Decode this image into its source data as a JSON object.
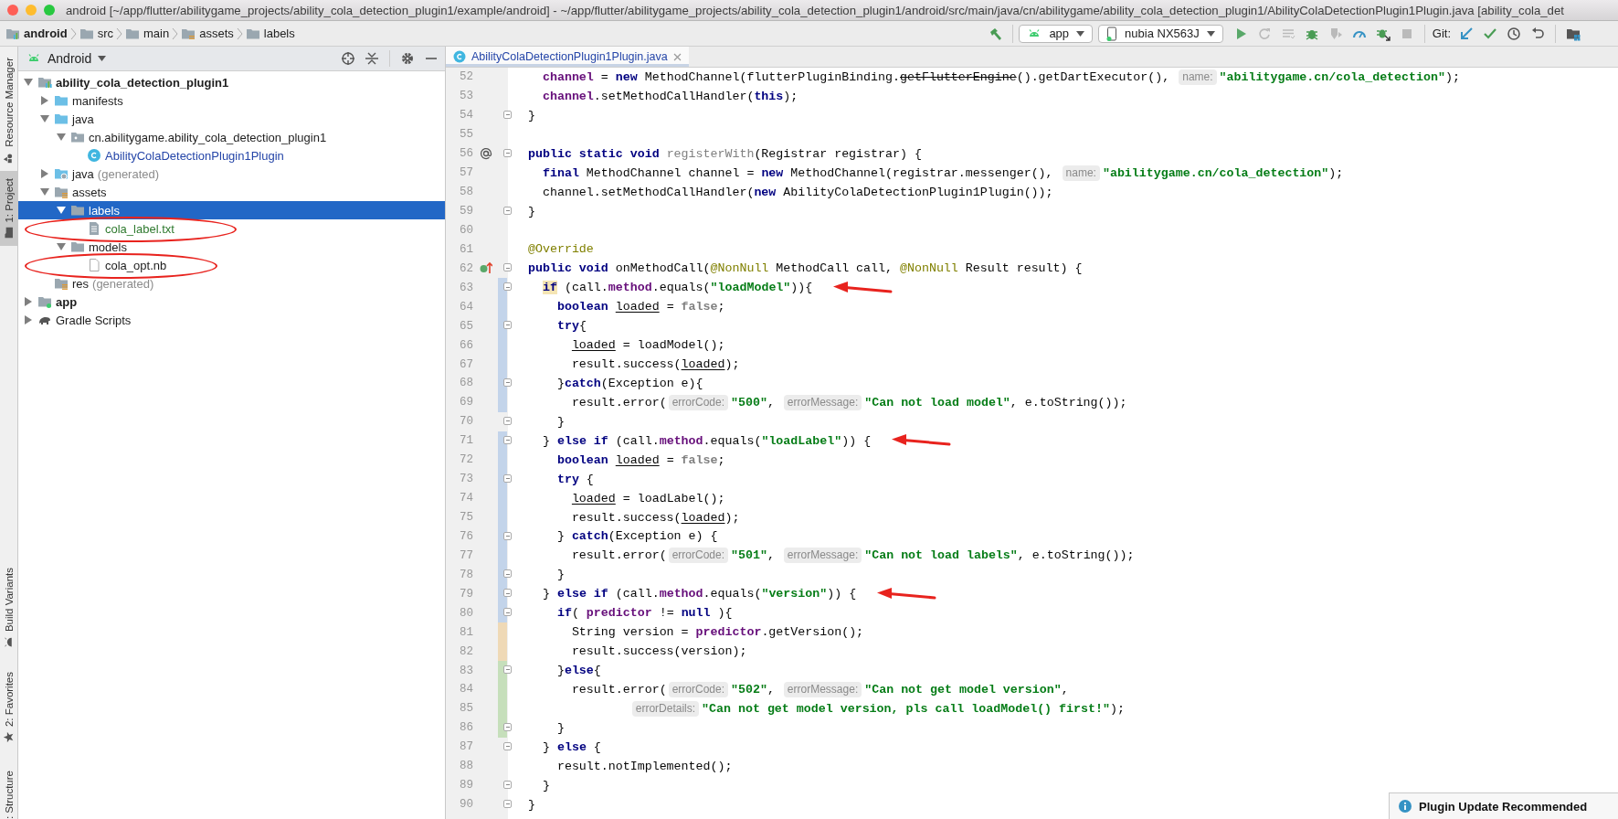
{
  "window": {
    "title": "android [~/app/flutter/abilitygame_projects/ability_cola_detection_plugin1/example/android] - ~/app/flutter/abilitygame_projects/ability_cola_detection_plugin1/android/src/main/java/cn/abilitygame/ability_cola_detection_plugin1/AbilityColaDetectionPlugin1Plugin.java [ability_cola_det"
  },
  "breadcrumbs": [
    {
      "label": "android",
      "kind": "module"
    },
    {
      "label": "src",
      "kind": "folder"
    },
    {
      "label": "main",
      "kind": "folder"
    },
    {
      "label": "assets",
      "kind": "resource-folder"
    },
    {
      "label": "labels",
      "kind": "folder"
    }
  ],
  "toolbar": [
    {
      "kind": "build",
      "disabled": false
    },
    {
      "kind": "separator"
    },
    {
      "kind": "config-dropdown",
      "label": "app",
      "disabled": false
    },
    {
      "kind": "device-dropdown",
      "label": "nubia NX563J",
      "disabled": false
    },
    {
      "kind": "run",
      "disabled": false
    },
    {
      "kind": "rerun",
      "disabled": true
    },
    {
      "kind": "apply-changes",
      "disabled": true
    },
    {
      "kind": "debug",
      "disabled": false
    },
    {
      "kind": "coverage",
      "disabled": true
    },
    {
      "kind": "profile",
      "disabled": false
    },
    {
      "kind": "attach-debugger",
      "disabled": false
    },
    {
      "kind": "stop",
      "disabled": true
    },
    {
      "kind": "separator"
    },
    {
      "kind": "label",
      "label": "Git:"
    },
    {
      "kind": "vcs-update",
      "disabled": false
    },
    {
      "kind": "vcs-commit",
      "disabled": false
    },
    {
      "kind": "history",
      "disabled": false
    },
    {
      "kind": "rollback",
      "disabled": false
    },
    {
      "kind": "separator"
    },
    {
      "kind": "project-structure",
      "disabled": false
    }
  ],
  "side_strip": {
    "top_tabs": [
      {
        "label": "Resource Manager",
        "kind": "resources",
        "selected": false
      },
      {
        "label": "1: Project",
        "kind": "project",
        "selected": true
      }
    ],
    "bottom_tabs": [
      {
        "label": "Build Variants",
        "kind": "build-variants",
        "selected": false
      },
      {
        "label": "2: Favorites",
        "kind": "favorites",
        "selected": false
      },
      {
        "label": ": Structure",
        "kind": "structure",
        "selected": false
      }
    ]
  },
  "project_panel": {
    "view": "Android",
    "tree": [
      {
        "label": "ability_cola_detection_plugin1",
        "kind": "module",
        "expanded": true,
        "selected": false,
        "marked": false,
        "children": [
          {
            "label": "manifests",
            "kind": "source-folder",
            "expanded": false,
            "selected": false,
            "marked": false
          },
          {
            "label": "java",
            "kind": "source-folder",
            "expanded": true,
            "selected": false,
            "marked": false,
            "children": [
              {
                "label": "cn.abilitygame.ability_cola_detection_plugin1",
                "kind": "package",
                "expanded": true,
                "selected": false,
                "marked": false,
                "children": [
                  {
                    "label": "AbilityColaDetectionPlugin1Plugin",
                    "kind": "class",
                    "selected": false,
                    "color": "#2445a8",
                    "marked": false
                  }
                ]
              }
            ]
          },
          {
            "label": "java",
            "note": "(generated)",
            "kind": "generated-folder",
            "expanded": false,
            "selected": false,
            "marked": false
          },
          {
            "label": "assets",
            "kind": "resource-folder",
            "expanded": true,
            "selected": false,
            "marked": false,
            "children": [
              {
                "label": "labels",
                "kind": "folder",
                "expanded": true,
                "selected": true,
                "marked": false,
                "children": [
                  {
                    "label": "cola_label.txt",
                    "kind": "text-file",
                    "selected": false,
                    "color": "#2f7a2f",
                    "marked": true
                  }
                ]
              },
              {
                "label": "models",
                "kind": "folder",
                "expanded": true,
                "selected": false,
                "marked": false,
                "children": [
                  {
                    "label": "cola_opt.nb",
                    "kind": "file",
                    "selected": false,
                    "marked": true
                  }
                ]
              }
            ]
          },
          {
            "label": "res",
            "note": "(generated)",
            "kind": "resource-folder",
            "selected": false,
            "marked": false
          }
        ]
      },
      {
        "label": "app",
        "kind": "app-module",
        "expanded": false,
        "selected": false,
        "marked": false
      },
      {
        "label": "Gradle Scripts",
        "kind": "gradle",
        "expanded": false,
        "selected": false,
        "marked": false
      }
    ]
  },
  "editor": {
    "tabs": [
      {
        "label": "AbilityColaDetectionPlugin1Plugin.java",
        "selected": true,
        "color": "#2445a8"
      }
    ],
    "lines": [
      {
        "number": "52",
        "fold": false,
        "arrow": false,
        "tokens": [
          {
            "kind": "field",
            "text": "  channel"
          },
          {
            "kind": "plain",
            "text": " = "
          },
          {
            "kind": "keyword",
            "text": "new"
          },
          {
            "kind": "plain",
            "text": " MethodChannel(flutterPluginBinding."
          },
          {
            "kind": "deprecated",
            "text": "getFlutterEngine"
          },
          {
            "kind": "plain",
            "text": "().getDartExecutor(), "
          },
          {
            "kind": "hint",
            "text": "name:"
          },
          {
            "kind": "string",
            "text": "\"abilitygame.cn/cola_detection\""
          },
          {
            "kind": "plain",
            "text": ");"
          }
        ]
      },
      {
        "number": "53",
        "fold": false,
        "arrow": false,
        "tokens": [
          {
            "kind": "field",
            "text": "  channel"
          },
          {
            "kind": "plain",
            "text": ".setMethodCallHandler("
          },
          {
            "kind": "keyword",
            "text": "this"
          },
          {
            "kind": "plain",
            "text": ");"
          }
        ]
      },
      {
        "number": "54",
        "fold": true,
        "arrow": false,
        "tokens": [
          {
            "kind": "plain",
            "text": "}"
          }
        ]
      },
      {
        "number": "55",
        "fold": false,
        "arrow": false
      },
      {
        "number": "56",
        "fold": true,
        "arrow": false,
        "kind": "implementing-method",
        "tokens": [
          {
            "kind": "keyword",
            "text": "public static void"
          },
          {
            "kind": "unused",
            "text": " registerWith"
          },
          {
            "kind": "plain",
            "text": "(Registrar registrar) {"
          }
        ]
      },
      {
        "number": "57",
        "fold": false,
        "arrow": false,
        "tokens": [
          {
            "kind": "keyword",
            "text": "  final"
          },
          {
            "kind": "plain",
            "text": " MethodChannel channel = "
          },
          {
            "kind": "keyword",
            "text": "new"
          },
          {
            "kind": "plain",
            "text": " MethodChannel(registrar.messenger(), "
          },
          {
            "kind": "hint",
            "text": "name:"
          },
          {
            "kind": "string",
            "text": "\"abilitygame.cn/cola_detection\""
          },
          {
            "kind": "plain",
            "text": ");"
          }
        ]
      },
      {
        "number": "58",
        "fold": false,
        "arrow": false,
        "tokens": [
          {
            "kind": "plain",
            "text": "  channel.setMethodCallHandler("
          },
          {
            "kind": "keyword",
            "text": "new"
          },
          {
            "kind": "plain",
            "text": " AbilityColaDetectionPlugin1Plugin());"
          }
        ]
      },
      {
        "number": "59",
        "fold": true,
        "arrow": false,
        "tokens": [
          {
            "kind": "plain",
            "text": "}"
          }
        ]
      },
      {
        "number": "60",
        "fold": false,
        "arrow": false
      },
      {
        "number": "61",
        "fold": false,
        "arrow": false,
        "tokens": [
          {
            "kind": "annotation",
            "text": "@Override"
          }
        ]
      },
      {
        "number": "62",
        "fold": true,
        "arrow": false,
        "kind": "overriding-method",
        "tokens": [
          {
            "kind": "keyword",
            "text": "public void"
          },
          {
            "kind": "plain",
            "text": " onMethodCall("
          },
          {
            "kind": "annotation",
            "text": "@NonNull"
          },
          {
            "kind": "plain",
            "text": " MethodCall call, "
          },
          {
            "kind": "annotation",
            "text": "@NonNull"
          },
          {
            "kind": "plain",
            "text": " Result result) {"
          }
        ]
      },
      {
        "number": "63",
        "fold": true,
        "arrow": true,
        "color": "#c3d4ea",
        "tokens": [
          {
            "kind": "keyword-match",
            "text": "  if"
          },
          {
            "kind": "plain",
            "text": " (call."
          },
          {
            "kind": "field",
            "text": "method"
          },
          {
            "kind": "plain",
            "text": ".equals("
          },
          {
            "kind": "string",
            "text": "\"loadModel\""
          },
          {
            "kind": "plain",
            "text": ")){"
          }
        ]
      },
      {
        "number": "64",
        "fold": false,
        "arrow": false,
        "color": "#c3d4ea",
        "tokens": [
          {
            "kind": "keyword",
            "text": "    boolean"
          },
          {
            "kind": "reassigned",
            "text": " loaded"
          },
          {
            "kind": "plain",
            "text": " = "
          },
          {
            "kind": "redundant",
            "text": "false"
          },
          {
            "kind": "plain",
            "text": ";"
          }
        ]
      },
      {
        "number": "65",
        "fold": true,
        "arrow": false,
        "color": "#c3d4ea",
        "tokens": [
          {
            "kind": "keyword",
            "text": "    try"
          },
          {
            "kind": "plain",
            "text": "{"
          }
        ]
      },
      {
        "number": "66",
        "fold": false,
        "arrow": false,
        "color": "#c3d4ea",
        "tokens": [
          {
            "kind": "reassigned",
            "text": "      loaded"
          },
          {
            "kind": "plain",
            "text": " = loadModel();"
          }
        ]
      },
      {
        "number": "67",
        "fold": false,
        "arrow": false,
        "color": "#c3d4ea",
        "tokens": [
          {
            "kind": "plain",
            "text": "      result.success("
          },
          {
            "kind": "reassigned",
            "text": "loaded"
          },
          {
            "kind": "plain",
            "text": ");"
          }
        ]
      },
      {
        "number": "68",
        "fold": true,
        "arrow": false,
        "color": "#c3d4ea",
        "tokens": [
          {
            "kind": "plain",
            "text": "    }"
          },
          {
            "kind": "keyword",
            "text": "catch"
          },
          {
            "kind": "plain",
            "text": "(Exception e){"
          }
        ]
      },
      {
        "number": "69",
        "fold": false,
        "arrow": false,
        "color": "#c3d4ea",
        "tokens": [
          {
            "kind": "plain",
            "text": "      result.error("
          },
          {
            "kind": "hint",
            "text": "errorCode:"
          },
          {
            "kind": "string",
            "text": "\"500\""
          },
          {
            "kind": "plain",
            "text": ", "
          },
          {
            "kind": "hint",
            "text": "errorMessage:"
          },
          {
            "kind": "string",
            "text": "\"Can not load model\""
          },
          {
            "kind": "plain",
            "text": ", e.toString());"
          }
        ]
      },
      {
        "number": "70",
        "fold": true,
        "arrow": false,
        "tokens": [
          {
            "kind": "plain",
            "text": "    }"
          }
        ]
      },
      {
        "number": "71",
        "fold": true,
        "arrow": true,
        "color": "#c3d4ea",
        "tokens": [
          {
            "kind": "plain",
            "text": "  } "
          },
          {
            "kind": "keyword",
            "text": "else if"
          },
          {
            "kind": "plain",
            "text": " (call."
          },
          {
            "kind": "field",
            "text": "method"
          },
          {
            "kind": "plain",
            "text": ".equals("
          },
          {
            "kind": "string",
            "text": "\"loadLabel\""
          },
          {
            "kind": "plain",
            "text": ")) {"
          }
        ]
      },
      {
        "number": "72",
        "fold": false,
        "arrow": false,
        "color": "#c3d4ea",
        "tokens": [
          {
            "kind": "keyword",
            "text": "    boolean"
          },
          {
            "kind": "reassigned",
            "text": " loaded"
          },
          {
            "kind": "plain",
            "text": " = "
          },
          {
            "kind": "redundant",
            "text": "false"
          },
          {
            "kind": "plain",
            "text": ";"
          }
        ]
      },
      {
        "number": "73",
        "fold": true,
        "arrow": false,
        "color": "#c3d4ea",
        "tokens": [
          {
            "kind": "keyword",
            "text": "    try"
          },
          {
            "kind": "plain",
            "text": " {"
          }
        ]
      },
      {
        "number": "74",
        "fold": false,
        "arrow": false,
        "color": "#c3d4ea",
        "tokens": [
          {
            "kind": "reassigned",
            "text": "      loaded"
          },
          {
            "kind": "plain",
            "text": " = loadLabel();"
          }
        ]
      },
      {
        "number": "75",
        "fold": false,
        "arrow": false,
        "color": "#c3d4ea",
        "tokens": [
          {
            "kind": "plain",
            "text": "      result.success("
          },
          {
            "kind": "reassigned",
            "text": "loaded"
          },
          {
            "kind": "plain",
            "text": ");"
          }
        ]
      },
      {
        "number": "76",
        "fold": true,
        "arrow": false,
        "color": "#c3d4ea",
        "tokens": [
          {
            "kind": "plain",
            "text": "    } "
          },
          {
            "kind": "keyword",
            "text": "catch"
          },
          {
            "kind": "plain",
            "text": "(Exception e) {"
          }
        ]
      },
      {
        "number": "77",
        "fold": false,
        "arrow": false,
        "color": "#c3d4ea",
        "tokens": [
          {
            "kind": "plain",
            "text": "      result.error("
          },
          {
            "kind": "hint",
            "text": "errorCode:"
          },
          {
            "kind": "string",
            "text": "\"501\""
          },
          {
            "kind": "plain",
            "text": ", "
          },
          {
            "kind": "hint",
            "text": "errorMessage:"
          },
          {
            "kind": "string",
            "text": "\"Can not load labels\""
          },
          {
            "kind": "plain",
            "text": ", e.toString());"
          }
        ]
      },
      {
        "number": "78",
        "fold": true,
        "arrow": false,
        "color": "#c3d4ea",
        "tokens": [
          {
            "kind": "plain",
            "text": "    }"
          }
        ]
      },
      {
        "number": "79",
        "fold": true,
        "arrow": true,
        "color": "#c3d4ea",
        "tokens": [
          {
            "kind": "plain",
            "text": "  } "
          },
          {
            "kind": "keyword",
            "text": "else if"
          },
          {
            "kind": "plain",
            "text": " (call."
          },
          {
            "kind": "field",
            "text": "method"
          },
          {
            "kind": "plain",
            "text": ".equals("
          },
          {
            "kind": "string",
            "text": "\"version\""
          },
          {
            "kind": "plain",
            "text": ")) {"
          }
        ]
      },
      {
        "number": "80",
        "fold": true,
        "arrow": false,
        "color": "#c3d4ea",
        "tokens": [
          {
            "kind": "keyword",
            "text": "    if"
          },
          {
            "kind": "plain",
            "text": "( "
          },
          {
            "kind": "field",
            "text": "predictor"
          },
          {
            "kind": "plain",
            "text": " != "
          },
          {
            "kind": "keyword",
            "text": "null"
          },
          {
            "kind": "plain",
            "text": " ){"
          }
        ]
      },
      {
        "number": "81",
        "fold": false,
        "arrow": false,
        "color": "#efd9b6",
        "tokens": [
          {
            "kind": "plain",
            "text": "      String version = "
          },
          {
            "kind": "field",
            "text": "predictor"
          },
          {
            "kind": "plain",
            "text": ".getVersion();"
          }
        ]
      },
      {
        "number": "82",
        "fold": false,
        "arrow": false,
        "color": "#efd9b6",
        "tokens": [
          {
            "kind": "plain",
            "text": "      result.success(version);"
          }
        ]
      },
      {
        "number": "83",
        "fold": true,
        "arrow": false,
        "color": "#c6dfbb",
        "tokens": [
          {
            "kind": "plain",
            "text": "    }"
          },
          {
            "kind": "keyword",
            "text": "else"
          },
          {
            "kind": "plain",
            "text": "{"
          }
        ]
      },
      {
        "number": "84",
        "fold": false,
        "arrow": false,
        "color": "#c6dfbb",
        "tokens": [
          {
            "kind": "plain",
            "text": "      result.error("
          },
          {
            "kind": "hint",
            "text": "errorCode:"
          },
          {
            "kind": "string",
            "text": "\"502\""
          },
          {
            "kind": "plain",
            "text": ", "
          },
          {
            "kind": "hint",
            "text": "errorMessage:"
          },
          {
            "kind": "string",
            "text": "\"Can not get model version\""
          },
          {
            "kind": "plain",
            "text": ","
          }
        ]
      },
      {
        "number": "85",
        "fold": false,
        "arrow": false,
        "color": "#c6dfbb",
        "tokens": [
          {
            "kind": "hint",
            "text": "              errorDetails:"
          },
          {
            "kind": "string",
            "text": "\"Can not get model version, pls call loadModel() first!\""
          },
          {
            "kind": "plain",
            "text": ");"
          }
        ]
      },
      {
        "number": "86",
        "fold": true,
        "arrow": false,
        "color": "#c6dfbb",
        "tokens": [
          {
            "kind": "plain",
            "text": "    }"
          }
        ]
      },
      {
        "number": "87",
        "fold": true,
        "arrow": false,
        "tokens": [
          {
            "kind": "plain",
            "text": "  } "
          },
          {
            "kind": "keyword",
            "text": "else"
          },
          {
            "kind": "plain",
            "text": " {"
          }
        ]
      },
      {
        "number": "88",
        "fold": false,
        "arrow": false,
        "tokens": [
          {
            "kind": "plain",
            "text": "    result.notImplemented();"
          }
        ]
      },
      {
        "number": "89",
        "fold": true,
        "arrow": false,
        "tokens": [
          {
            "kind": "plain",
            "text": "  }"
          }
        ]
      },
      {
        "number": "90",
        "fold": true,
        "arrow": false,
        "tokens": [
          {
            "kind": "plain",
            "text": "}"
          }
        ]
      }
    ]
  },
  "notification": {
    "title": "Plugin Update Recommended"
  }
}
